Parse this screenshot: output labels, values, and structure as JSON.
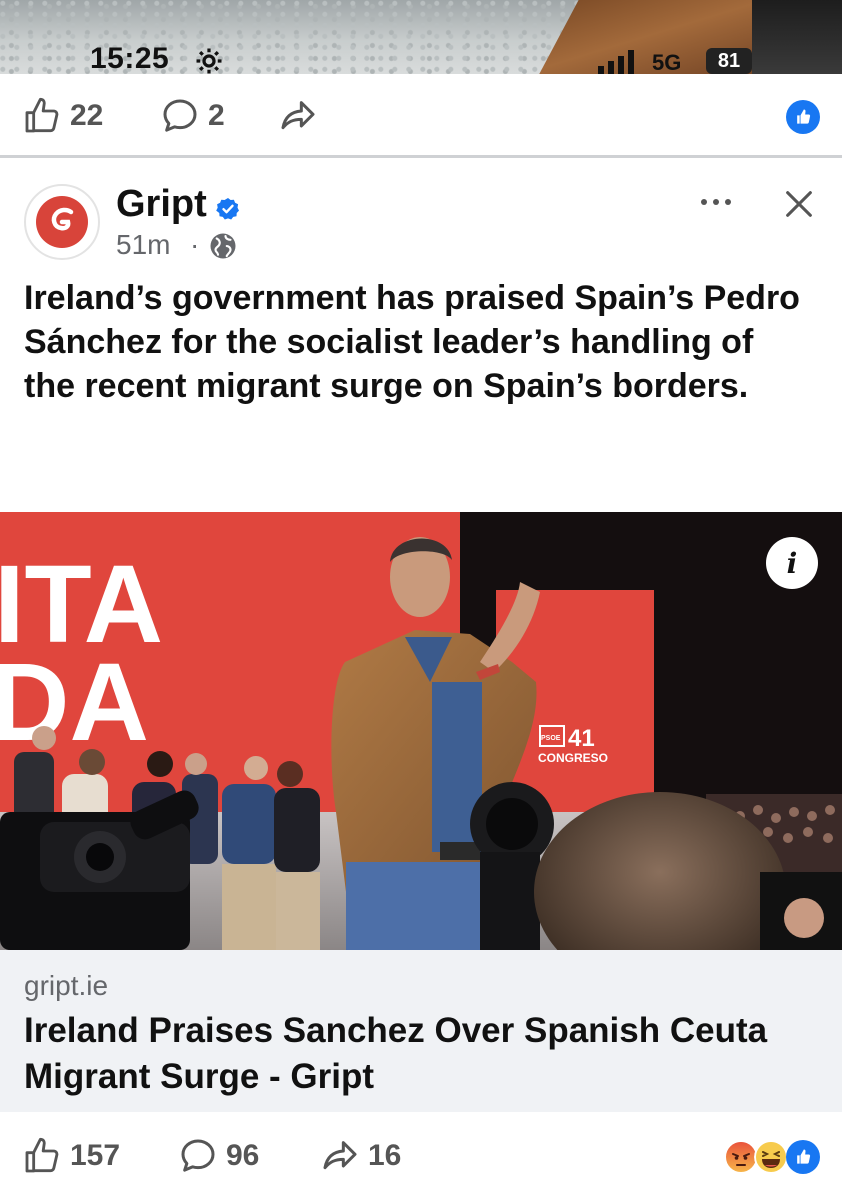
{
  "status_bar": {
    "time": "15:25",
    "network": "5G",
    "battery": "81"
  },
  "previous_post": {
    "likes": "22",
    "comments": "2"
  },
  "post": {
    "page_name": "Gript",
    "time_ago": "51m",
    "separator": "·",
    "text": "Ireland’s government has praised Spain’s Pedro Sánchez for the socialist leader’s handling of the recent migrant surge on Spain’s borders.",
    "link": {
      "domain": "gript.ie",
      "title": "Ireland Praises Sanchez Over Spanish Ceuta Migrant Surge - Gript"
    },
    "likes": "157",
    "comments": "96",
    "shares": "16",
    "info_label": "i"
  },
  "photo_text": {
    "banner_line1": "ITA",
    "banner_line2": "DA",
    "sign_number": "41",
    "sign_word": "CONGRESO",
    "sign_brand": "PSOE"
  },
  "colors": {
    "facebook_blue": "#1877f2",
    "brand_red": "#e0463d",
    "muted_text": "#65676b"
  },
  "icons": [
    "gear-icon",
    "signal-icon",
    "like-icon",
    "comment-icon",
    "share-icon",
    "verified-icon",
    "globe-icon",
    "more-icon",
    "close-icon",
    "info-icon",
    "angry-reaction-icon",
    "haha-reaction-icon",
    "like-reaction-icon"
  ]
}
